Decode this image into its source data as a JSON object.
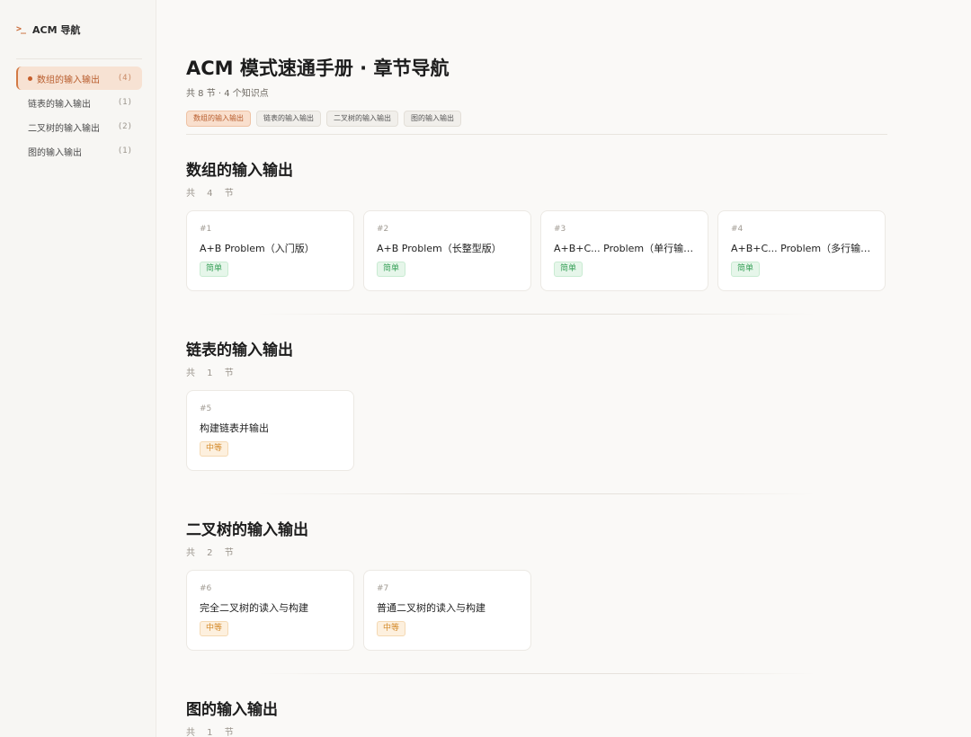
{
  "sidebar": {
    "brand_icon": ">_",
    "brand": "ACM 导航",
    "items": [
      {
        "label": "数组的输入输出",
        "count": "(4)"
      },
      {
        "label": "链表的输入输出",
        "count": "(1)"
      },
      {
        "label": "二叉树的输入输出",
        "count": "(2)"
      },
      {
        "label": "图的输入输出",
        "count": "(1)"
      }
    ]
  },
  "header": {
    "title": "ACM 模式速通手册 · 章节导航",
    "subtitle": "共 8 节 · 4 个知识点",
    "chips": [
      "数组的输入输出",
      "链表的输入输出",
      "二叉树的输入输出",
      "图的输入输出"
    ]
  },
  "sections": [
    {
      "title": "数组的输入输出",
      "count": "共 4 节",
      "cards": [
        {
          "num": "#1",
          "title": "A+B Problem（入门版）",
          "level": "简单"
        },
        {
          "num": "#2",
          "title": "A+B Problem（长整型版）",
          "level": "简单"
        },
        {
          "num": "#3",
          "title": "A+B+C... Problem（单行输入）",
          "level": "简单"
        },
        {
          "num": "#4",
          "title": "A+B+C... Problem（多行输入）",
          "level": "简单"
        }
      ]
    },
    {
      "title": "链表的输入输出",
      "count": "共 1 节",
      "cards": [
        {
          "num": "#5",
          "title": "构建链表并输出",
          "level": "中等"
        }
      ]
    },
    {
      "title": "二叉树的输入输出",
      "count": "共 2 节",
      "cards": [
        {
          "num": "#6",
          "title": "完全二叉树的读入与构建",
          "level": "中等"
        },
        {
          "num": "#7",
          "title": "普通二叉树的读入与构建",
          "level": "中等"
        }
      ]
    },
    {
      "title": "图的输入输出",
      "count": "共 1 节"
    }
  ],
  "colors": {
    "accent": "#c96a36",
    "easy": "#3aa15a",
    "medium": "#d48a2a"
  }
}
